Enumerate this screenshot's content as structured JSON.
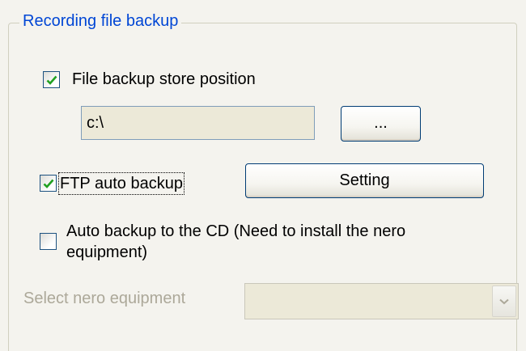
{
  "group": {
    "title": "Recording file backup"
  },
  "file_backup": {
    "label": "File backup store position",
    "checked": true,
    "path_value": "c:\\",
    "browse_label": "..."
  },
  "ftp_backup": {
    "label": "FTP auto backup",
    "checked": true,
    "setting_label": "Setting"
  },
  "cd_backup": {
    "label": "Auto backup to the CD (Need to install the nero equipment)",
    "checked": false
  },
  "nero": {
    "label": "Select nero equipment",
    "selected_value": "",
    "enabled": false
  },
  "colors": {
    "group_title": "#0046d5",
    "checkmark": "#21a121",
    "disabled_text": "#aca899",
    "button_border": "#003c74"
  },
  "icons": {
    "checkmark": "checkmark-icon",
    "dropdown": "chevron-down-icon"
  }
}
